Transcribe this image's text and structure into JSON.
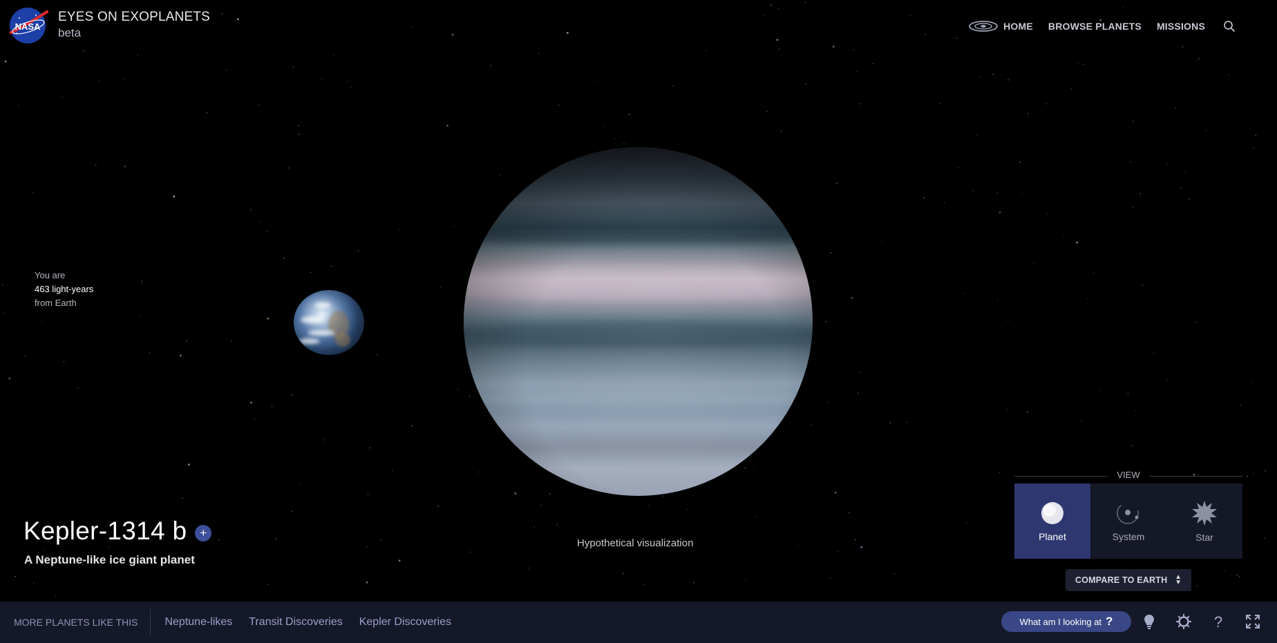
{
  "header": {
    "app_title": "EYES ON EXOPLANETS",
    "app_subtitle": "beta",
    "logo_text": "NASA"
  },
  "nav": {
    "home": "HOME",
    "browse": "BROWSE PLANETS",
    "missions": "MISSIONS",
    "search_icon": "search-icon",
    "home_icon": "galaxy-icon"
  },
  "distance": {
    "prefix": "You are",
    "value": "463 light-years",
    "suffix": "from Earth"
  },
  "planet": {
    "name": "Kepler-1314 b",
    "add_label": "+",
    "description": "A Neptune-like ice giant planet",
    "visualization_note": "Hypothetical visualization"
  },
  "view": {
    "label": "VIEW",
    "tabs": [
      {
        "label": "Planet",
        "icon": "planet-icon",
        "active": true
      },
      {
        "label": "System",
        "icon": "system-orbit-icon",
        "active": false
      },
      {
        "label": "Star",
        "icon": "star-burst-icon",
        "active": false
      }
    ],
    "compare_label": "COMPARE TO EARTH"
  },
  "bottom_bar": {
    "more_label": "MORE PLANETS LIKE THIS",
    "links": [
      "Neptune-likes",
      "Transit Discoveries",
      "Kepler Discoveries"
    ],
    "what_label": "What am I looking at",
    "what_q": "?",
    "icons": [
      "lightbulb-icon",
      "gear-icon",
      "help-icon",
      "fullscreen-icon"
    ]
  },
  "colors": {
    "background": "#000000",
    "bottom_bar": "#141828",
    "accent": "#3a4786",
    "active_tab": "#2e3770"
  }
}
